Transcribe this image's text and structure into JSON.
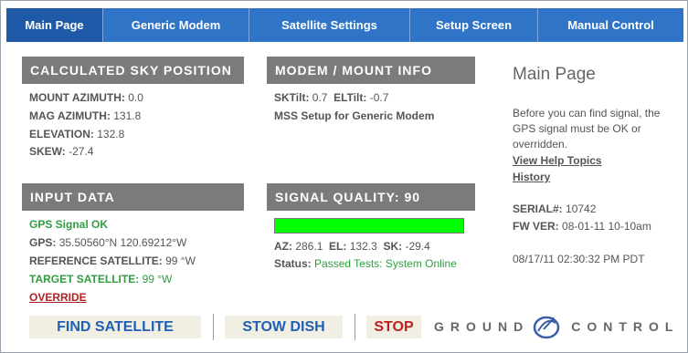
{
  "tabs": [
    {
      "label": "Main Page",
      "active": true
    },
    {
      "label": "Generic Modem",
      "active": false
    },
    {
      "label": "Satellite Settings",
      "active": false
    },
    {
      "label": "Setup Screen",
      "active": false
    },
    {
      "label": "Manual Control",
      "active": false
    }
  ],
  "sky": {
    "title": "CALCULATED SKY POSITION",
    "mount_azimuth_label": "MOUNT AZIMUTH:",
    "mount_azimuth": "0.0",
    "mag_azimuth_label": "MAG AZIMUTH:",
    "mag_azimuth": "131.8",
    "elevation_label": "ELEVATION:",
    "elevation": "132.8",
    "skew_label": "SKEW:",
    "skew": "-27.4"
  },
  "modem": {
    "title": "MODEM / MOUNT INFO",
    "sktilt_label": "SKTilt:",
    "sktilt": "0.7",
    "eltilt_label": "ELTilt:",
    "eltilt": "-0.7",
    "setup_text": "MSS Setup for Generic Modem"
  },
  "input": {
    "title": "INPUT DATA",
    "gps_status": "GPS Signal OK",
    "gps_label": "GPS:",
    "gps_value": "35.50560°N 120.69212°W",
    "ref_sat_label": "REFERENCE SATELLITE:",
    "ref_sat_value": "99 °W",
    "target_sat_label": "TARGET SATELLITE:",
    "target_sat_value": "99 °W",
    "override": "OVERRIDE"
  },
  "signal": {
    "title": "SIGNAL QUALITY: 90",
    "quality": 90,
    "bar_color": "#00ff00",
    "az_label": "AZ:",
    "az": "286.1",
    "el_label": "EL:",
    "el": "132.3",
    "sk_label": "SK:",
    "sk": "-29.4",
    "status_label": "Status:",
    "status_value": "Passed Tests: System Online"
  },
  "sidebar": {
    "title": "Main Page",
    "help_text_1": "Before you can find signal, the",
    "help_text_2": "GPS signal must be OK or",
    "help_text_3": "overridden.",
    "view_help": "View Help Topics",
    "history": "History",
    "serial_label": "SERIAL#:",
    "serial": "10742",
    "fw_label": "FW VER:",
    "fw": "08-01-11 10-10am",
    "timestamp": "08/17/11 02:30:32 PM PDT"
  },
  "buttons": {
    "find": "FIND SATELLITE",
    "stow": "STOW DISH",
    "stop": "STOP"
  },
  "logo": {
    "left_word": "GROUND",
    "right_word": "CONTROL"
  },
  "colors": {
    "tab_bar": "#2f74c6",
    "tab_active": "#1f5aa8",
    "section_header": "#7b7b7b",
    "ok_green": "#2e9e3e",
    "stop_red": "#c01f1f",
    "button_blue": "#1f5fb5"
  }
}
